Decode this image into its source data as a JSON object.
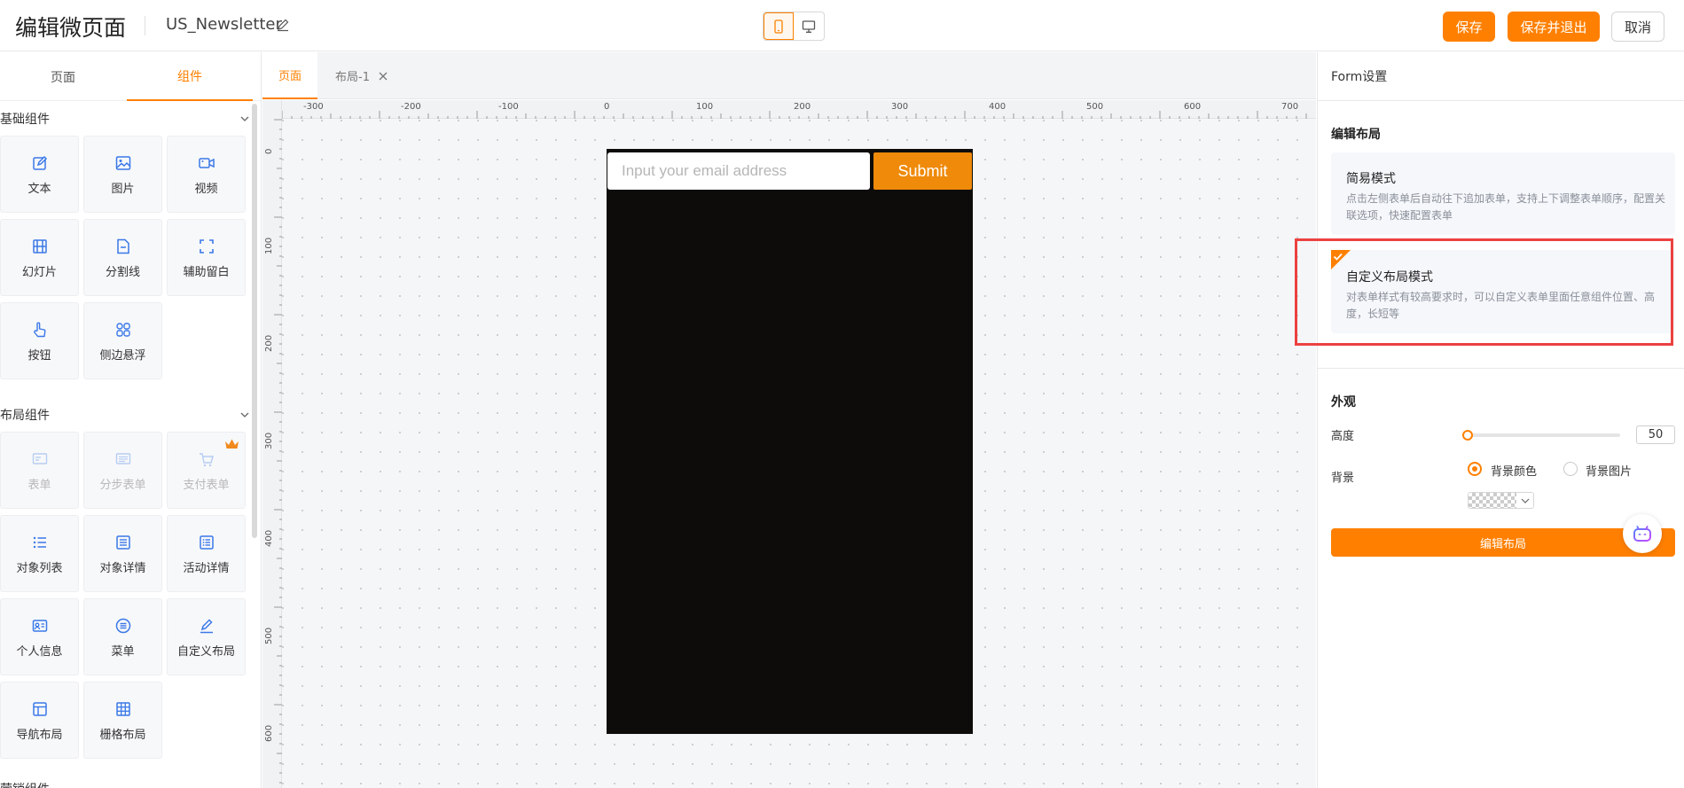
{
  "header": {
    "title": "编辑微页面",
    "file_name": "US_Newsletter",
    "save": "保存",
    "save_exit": "保存并退出",
    "cancel": "取消"
  },
  "left_panel": {
    "tabs": [
      "页面",
      "组件"
    ],
    "active_tab": "组件",
    "basic_title": "基础组件",
    "basic": [
      {
        "label": "文本",
        "icon": "edit-text-icon"
      },
      {
        "label": "图片",
        "icon": "image-icon"
      },
      {
        "label": "视频",
        "icon": "video-icon"
      },
      {
        "label": "幻灯片",
        "icon": "film-icon"
      },
      {
        "label": "分割线",
        "icon": "document-icon"
      },
      {
        "label": "辅助留白",
        "icon": "expand-corners-icon"
      },
      {
        "label": "按钮",
        "icon": "pointer-hand-icon"
      },
      {
        "label": "侧边悬浮",
        "icon": "grid-four-icon"
      }
    ],
    "layout_title": "布局组件",
    "layout": [
      {
        "label": "表单",
        "icon": "form-icon",
        "disabled": true
      },
      {
        "label": "分步表单",
        "icon": "step-form-icon",
        "disabled": true
      },
      {
        "label": "支付表单",
        "icon": "cart-icon",
        "disabled": true
      },
      {
        "label": "对象列表",
        "icon": "list-icon"
      },
      {
        "label": "对象详情",
        "icon": "detail-icon"
      },
      {
        "label": "活动详情",
        "icon": "event-detail-icon"
      },
      {
        "label": "个人信息",
        "icon": "id-card-icon"
      },
      {
        "label": "菜单",
        "icon": "menu-circle-icon"
      },
      {
        "label": "自定义布局",
        "icon": "pen-icon"
      },
      {
        "label": "导航布局",
        "icon": "nav-layout-icon"
      },
      {
        "label": "栅格布局",
        "icon": "grid-layout-icon"
      }
    ],
    "next_section": "营销组件"
  },
  "canvas": {
    "tabs": [
      "页面",
      "布局-1"
    ],
    "ruler_x": [
      "-300",
      "-200",
      "-100",
      "0",
      "100",
      "200",
      "300",
      "400",
      "500",
      "600",
      "700"
    ],
    "ruler_y": [
      "0",
      "100",
      "200",
      "300",
      "400",
      "500",
      "600"
    ],
    "email_placeholder": "Input your email address",
    "submit_label": "Submit"
  },
  "right_panel": {
    "title": "Form设置",
    "layout_section": "编辑布局",
    "simple_mode": {
      "title": "简易模式",
      "desc": "点击左侧表单后自动往下追加表单，支持上下调整表单顺序，配置关联选项，快速配置表单"
    },
    "custom_mode": {
      "title": "自定义布局模式",
      "desc": "对表单样式有较高要求时，可以自定义表单里面任意组件位置、高度，长短等",
      "selected": true
    },
    "appearance_section": "外观",
    "height_label": "高度",
    "height_value": "50",
    "bg_label": "背景",
    "bg_color": "背景颜色",
    "bg_image": "背景图片",
    "edit_layout_btn": "编辑布局"
  },
  "colors": {
    "accent": "#ff8000",
    "phone_bg": "#0d0c0b",
    "highlight": "#ec4141"
  }
}
